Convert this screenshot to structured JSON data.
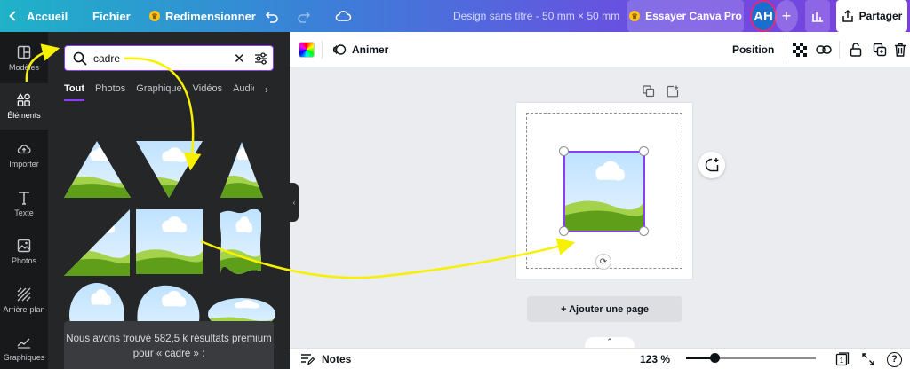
{
  "topbar": {
    "home": "Accueil",
    "file": "Fichier",
    "resize": "Redimensionner",
    "title": "Design sans titre - 50 mm × 50 mm",
    "try_pro": "Essayer Canva Pro",
    "avatar": "AH",
    "plus": "+",
    "share": "Partager"
  },
  "rail": {
    "items": [
      {
        "label": "Modèles",
        "icon": "template-icon"
      },
      {
        "label": "Éléments",
        "icon": "shapes-icon"
      },
      {
        "label": "Importer",
        "icon": "cloud-upload-icon"
      },
      {
        "label": "Texte",
        "icon": "text-icon"
      },
      {
        "label": "Photos",
        "icon": "image-icon"
      },
      {
        "label": "Arrière-plan",
        "icon": "pattern-icon"
      },
      {
        "label": "Graphiques",
        "icon": "chart-icon"
      }
    ]
  },
  "search": {
    "value": "cadre",
    "tabs": [
      "Tout",
      "Photos",
      "Graphique",
      "Vidéos",
      "Audio"
    ],
    "result_text": "Nous avons trouvé 582,5 k résultats premium pour « cadre » :"
  },
  "toolbar": {
    "animate": "Animer",
    "position": "Position"
  },
  "canvas": {
    "add_page": "+ Ajouter une page"
  },
  "bottombar": {
    "notes": "Notes",
    "zoom": "123 %",
    "zoom_fraction": 0.22,
    "page_count": "1",
    "help": "?"
  },
  "colors": {
    "accent": "#8b3dff",
    "sky_top": "#bfe2ff",
    "sky_bottom": "#e7f4ff",
    "hill_light": "#a4d24a",
    "hill_dark": "#5e9e18",
    "arrow": "#f7f000"
  }
}
